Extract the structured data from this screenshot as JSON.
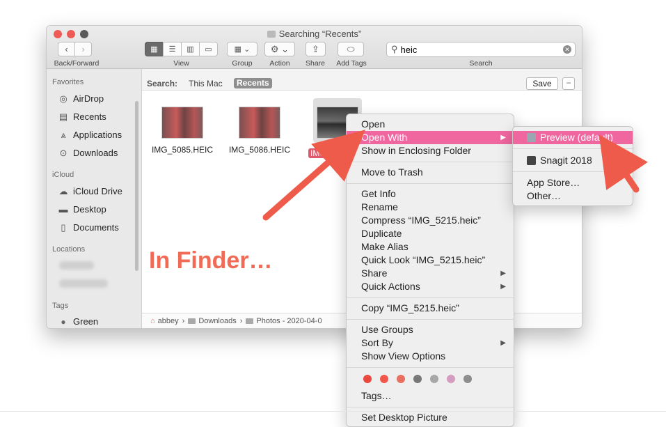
{
  "window": {
    "title": "Searching “Recents”",
    "toolbar": {
      "back_forward_label": "Back/Forward",
      "view_label": "View",
      "group_label": "Group",
      "action_label": "Action",
      "share_label": "Share",
      "add_tags_label": "Add Tags",
      "search_label": "Search",
      "search_value": "heic"
    }
  },
  "sidebar": {
    "favorites_header": "Favorites",
    "favorites": [
      {
        "label": "AirDrop",
        "icon": "airdrop-icon"
      },
      {
        "label": "Recents",
        "icon": "recents-icon"
      },
      {
        "label": "Applications",
        "icon": "applications-icon"
      },
      {
        "label": "Downloads",
        "icon": "downloads-icon"
      }
    ],
    "icloud_header": "iCloud",
    "icloud": [
      {
        "label": "iCloud Drive",
        "icon": "cloud-icon"
      },
      {
        "label": "Desktop",
        "icon": "desktop-icon"
      },
      {
        "label": "Documents",
        "icon": "documents-icon"
      }
    ],
    "locations_header": "Locations",
    "tags_header": "Tags",
    "tags": [
      {
        "label": "Green",
        "icon": "tag-dot-icon"
      }
    ]
  },
  "scope_bar": {
    "label": "Search:",
    "this_mac": "This Mac",
    "recents": "Recents",
    "save": "Save",
    "minus": "−"
  },
  "files": [
    {
      "name": "IMG_5085.HEIC"
    },
    {
      "name": "IMG_5086.HEIC"
    },
    {
      "name": "IMG_52"
    }
  ],
  "path_bar": {
    "items": [
      "abbey",
      "Downloads",
      "Photos - 2020-04-0"
    ]
  },
  "annotation": {
    "text": "In Finder…",
    "color": "#f16a56"
  },
  "context_menu": {
    "open": "Open",
    "open_with": "Open With",
    "show_in_enclosing_folder": "Show in Enclosing Folder",
    "move_to_trash": "Move to Trash",
    "get_info": "Get Info",
    "rename": "Rename",
    "compress": "Compress “IMG_5215.heic”",
    "duplicate": "Duplicate",
    "make_alias": "Make Alias",
    "quick_look": "Quick Look “IMG_5215.heic”",
    "share": "Share",
    "quick_actions": "Quick Actions",
    "copy": "Copy “IMG_5215.heic”",
    "use_groups": "Use Groups",
    "sort_by": "Sort By",
    "show_view_options": "Show View Options",
    "tag_colors": [
      "#e8483d",
      "#f0584c",
      "#e87060",
      "#777777",
      "#a8a8a8",
      "#d39bbd",
      "#8d8d8d"
    ],
    "tags": "Tags…",
    "set_desktop_picture": "Set Desktop Picture",
    "highlight_color": "#f0679f"
  },
  "open_with_submenu": {
    "preview_default": "Preview (default)",
    "snagit": "Snagit 2018",
    "app_store": "App Store…",
    "other": "Other…"
  }
}
